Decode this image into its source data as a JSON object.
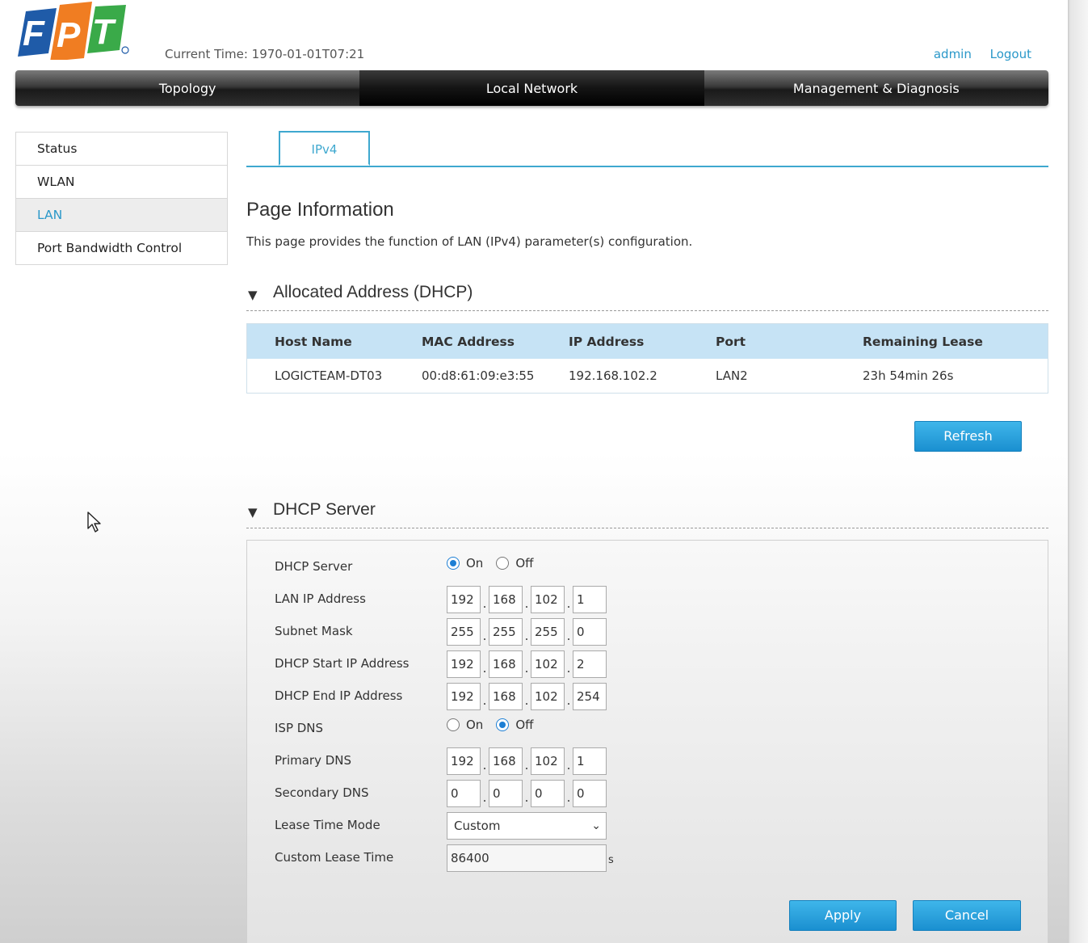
{
  "header": {
    "logo_text": "FPT",
    "current_time_label": "Current Time:",
    "current_time_value": "1970-01-01T07:21",
    "user": "admin",
    "logout": "Logout"
  },
  "nav": {
    "items": [
      "Topology",
      "Local Network",
      "Management & Diagnosis"
    ],
    "active": "Local Network"
  },
  "sidebar": {
    "items": [
      "Status",
      "WLAN",
      "LAN",
      "Port Bandwidth Control"
    ],
    "active": "LAN"
  },
  "tabs": {
    "items": [
      "IPv4"
    ],
    "active": "IPv4"
  },
  "page": {
    "title": "Page Information",
    "description": "This page provides the function of LAN (IPv4) parameter(s) configuration."
  },
  "allocated": {
    "title": "Allocated Address (DHCP)",
    "columns": [
      "Host Name",
      "MAC Address",
      "IP Address",
      "Port",
      "Remaining Lease"
    ],
    "rows": [
      [
        "LOGICTEAM-DT03",
        "00:d8:61:09:e3:55",
        "192.168.102.2",
        "LAN2",
        "23h 54min 26s"
      ]
    ],
    "refresh_label": "Refresh"
  },
  "dhcp": {
    "title": "DHCP Server",
    "server_label": "DHCP Server",
    "on_label": "On",
    "off_label": "Off",
    "server_enabled": true,
    "lan_ip_label": "LAN IP Address",
    "lan_ip": [
      "192",
      "168",
      "102",
      "1"
    ],
    "subnet_label": "Subnet Mask",
    "subnet": [
      "255",
      "255",
      "255",
      "0"
    ],
    "start_label": "DHCP Start IP Address",
    "start_ip": [
      "192",
      "168",
      "102",
      "2"
    ],
    "end_label": "DHCP End IP Address",
    "end_ip": [
      "192",
      "168",
      "102",
      "254"
    ],
    "isp_dns_label": "ISP DNS",
    "isp_dns_enabled": false,
    "primary_dns_label": "Primary DNS",
    "primary_dns": [
      "192",
      "168",
      "102",
      "1"
    ],
    "secondary_dns_label": "Secondary DNS",
    "secondary_dns": [
      "0",
      "0",
      "0",
      "0"
    ],
    "lease_mode_label": "Lease Time Mode",
    "lease_mode_value": "Custom",
    "custom_lease_label": "Custom Lease Time",
    "custom_lease_value": "86400",
    "custom_lease_unit": "s",
    "apply_label": "Apply",
    "cancel_label": "Cancel"
  },
  "colors": {
    "accent": "#2a98c9",
    "table_header": "#c6e3f5",
    "button": "#1a8fd0"
  }
}
